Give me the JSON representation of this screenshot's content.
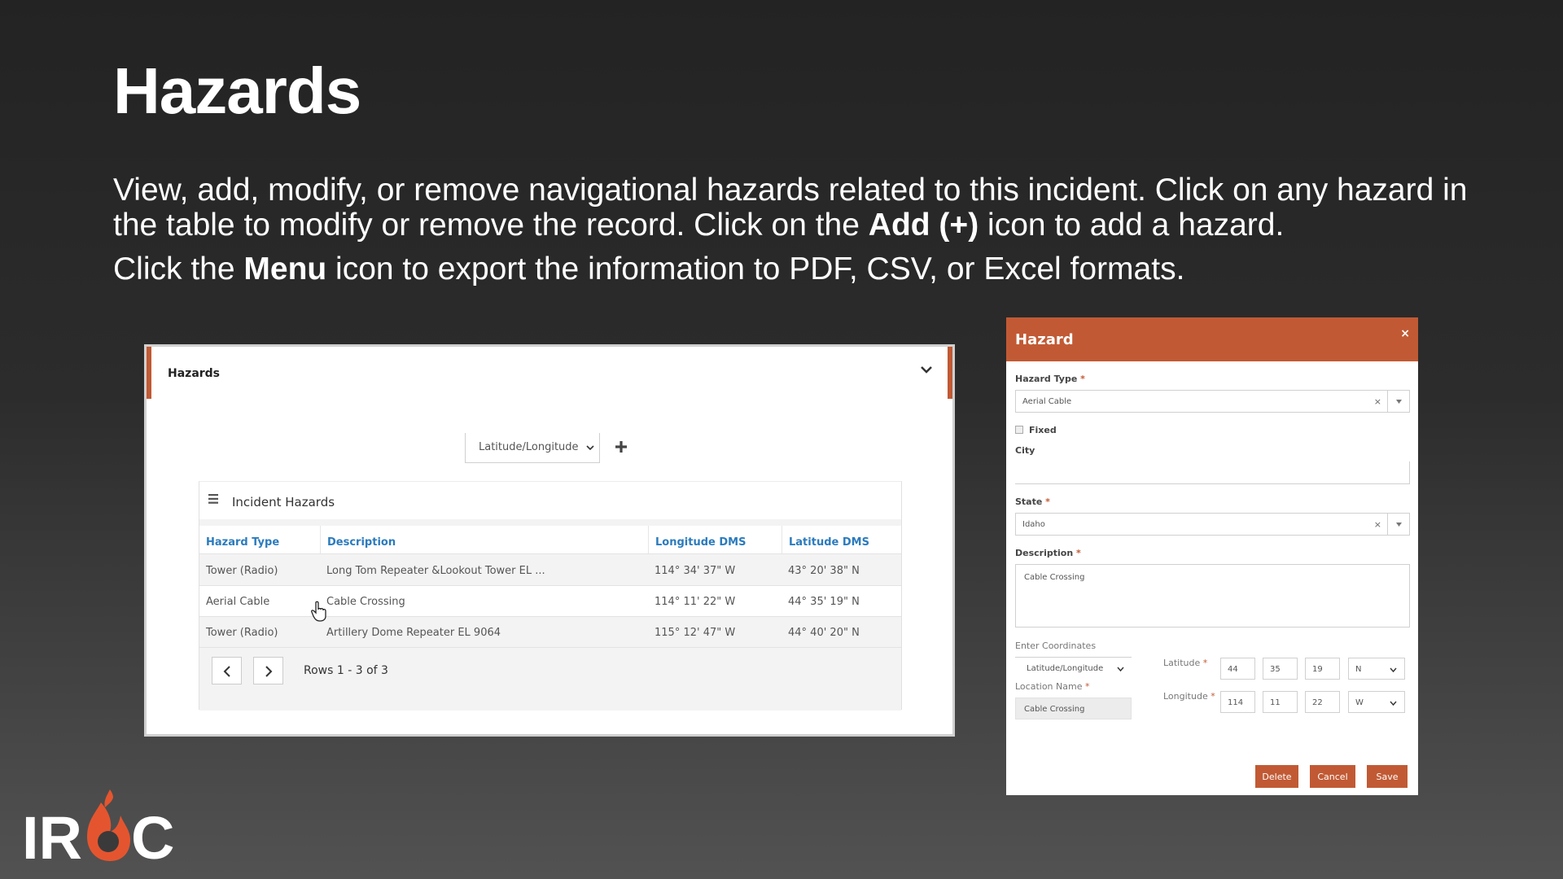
{
  "slide": {
    "title": "Hazards",
    "para1_a": "View, add, modify, or remove navigational hazards related to this incident. Click on any hazard in the table to modify or remove the record. Click on the ",
    "para1_bold": "Add (+)",
    "para1_b": " icon to add a hazard.",
    "para2_a": "Click the ",
    "para2_bold": "Menu",
    "para2_b": " icon to export the information to PDF, CSV, or Excel formats."
  },
  "panel": {
    "title": "Hazards",
    "coord_select": "Latitude/Longitude",
    "grid_title": "Incident Hazards",
    "columns": [
      "Hazard Type",
      "Description",
      "Longitude DMS",
      "Latitude DMS"
    ],
    "rows": [
      [
        "Tower (Radio)",
        "Long Tom Repeater &Lookout Tower  EL ...",
        "114° 34' 37\" W",
        "43° 20' 38\" N"
      ],
      [
        "Aerial Cable",
        "Cable Crossing",
        "114° 11' 22\" W",
        "44° 35' 19\" N"
      ],
      [
        "Tower (Radio)",
        "Artillery Dome Repeater EL 9064",
        "115° 12' 47\" W",
        "44° 40' 20\" N"
      ]
    ],
    "pager_text": "Rows 1 - 3 of 3"
  },
  "dialog": {
    "title": "Hazard",
    "close": "×",
    "hazard_type_label": "Hazard Type",
    "hazard_type_value": "Aerial Cable",
    "fixed_label": "Fixed",
    "city_label": "City",
    "city_value": "",
    "state_label": "State",
    "state_value": "Idaho",
    "description_label": "Description",
    "description_value": "Cable Crossing",
    "enter_coords_label": "Enter Coordinates",
    "enter_coords_value": "Latitude/Longitude",
    "location_name_label": "Location Name",
    "location_name_value": "Cable Crossing",
    "latitude_label": "Latitude",
    "latitude": [
      "44",
      "35",
      "19",
      "N"
    ],
    "longitude_label": "Longitude",
    "longitude": [
      "114",
      "11",
      "22",
      "W"
    ],
    "required_mark": "*",
    "clear_mark": "×",
    "buttons": {
      "delete": "Delete",
      "cancel": "Cancel",
      "save": "Save"
    }
  },
  "logo": {
    "text_left": "IR",
    "text_right": "C"
  },
  "colors": {
    "accent": "#c15a34",
    "link": "#2b7bbd",
    "background": "#2a2a2a"
  }
}
